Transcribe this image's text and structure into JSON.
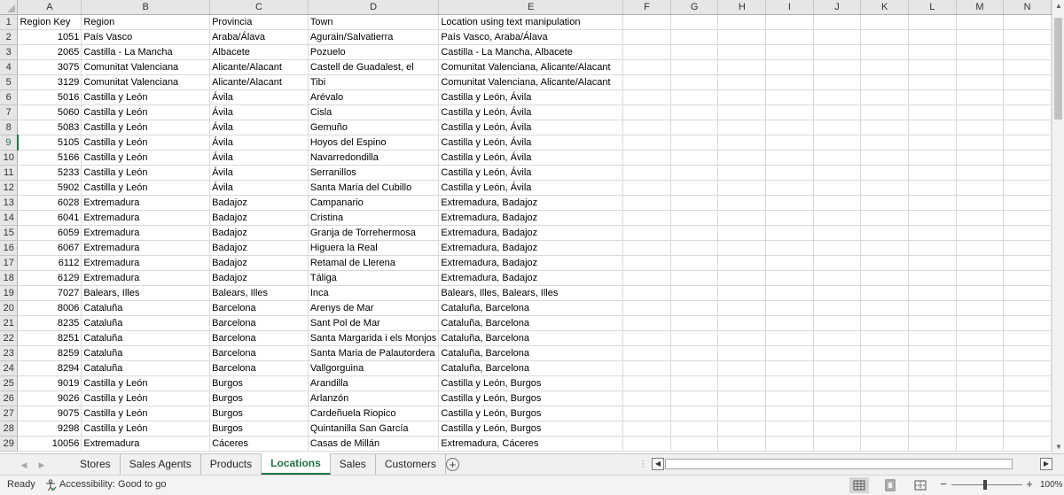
{
  "columns": [
    "A",
    "B",
    "C",
    "D",
    "E",
    "F",
    "G",
    "H",
    "I",
    "J",
    "K",
    "L",
    "M",
    "N"
  ],
  "rows": [
    [
      "Region Key",
      "Region",
      "Provincia",
      "Town",
      "Location using text manipulation"
    ],
    [
      "1051",
      "País Vasco",
      "Araba/Álava",
      "Agurain/Salvatierra",
      "País Vasco, Araba/Álava"
    ],
    [
      "2065",
      "Castilla - La Mancha",
      "Albacete",
      "Pozuelo",
      "Castilla - La Mancha, Albacete"
    ],
    [
      "3075",
      "Comunitat Valenciana",
      "Alicante/Alacant",
      "Castell de Guadalest, el",
      "Comunitat Valenciana, Alicante/Alacant"
    ],
    [
      "3129",
      "Comunitat Valenciana",
      "Alicante/Alacant",
      "Tibi",
      "Comunitat Valenciana, Alicante/Alacant"
    ],
    [
      "5016",
      "Castilla y León",
      "Ávila",
      "Arévalo",
      "Castilla y León, Ávila"
    ],
    [
      "5060",
      "Castilla y León",
      "Ávila",
      "Cisla",
      "Castilla y León, Ávila"
    ],
    [
      "5083",
      "Castilla y León",
      "Ávila",
      "Gemuño",
      "Castilla y León, Ávila"
    ],
    [
      "5105",
      "Castilla y León",
      "Ávila",
      "Hoyos del Espino",
      "Castilla y León, Ávila"
    ],
    [
      "5166",
      "Castilla y León",
      "Ávila",
      "Navarredondilla",
      "Castilla y León, Ávila"
    ],
    [
      "5233",
      "Castilla y León",
      "Ávila",
      "Serranillos",
      "Castilla y León, Ávila"
    ],
    [
      "5902",
      "Castilla y León",
      "Ávila",
      "Santa María del Cubillo",
      "Castilla y León, Ávila"
    ],
    [
      "6028",
      "Extremadura",
      "Badajoz",
      "Campanario",
      "Extremadura, Badajoz"
    ],
    [
      "6041",
      "Extremadura",
      "Badajoz",
      "Cristina",
      "Extremadura, Badajoz"
    ],
    [
      "6059",
      "Extremadura",
      "Badajoz",
      "Granja de Torrehermosa",
      "Extremadura, Badajoz"
    ],
    [
      "6067",
      "Extremadura",
      "Badajoz",
      "Higuera la Real",
      "Extremadura, Badajoz"
    ],
    [
      "6112",
      "Extremadura",
      "Badajoz",
      "Retamal de Llerena",
      "Extremadura, Badajoz"
    ],
    [
      "6129",
      "Extremadura",
      "Badajoz",
      "Táliga",
      "Extremadura, Badajoz"
    ],
    [
      "7027",
      "Balears, Illes",
      "Balears, Illes",
      "Inca",
      "Balears, Illes, Balears, Illes"
    ],
    [
      "8006",
      "Cataluña",
      "Barcelona",
      "Arenys de Mar",
      "Cataluña, Barcelona"
    ],
    [
      "8235",
      "Cataluña",
      "Barcelona",
      "Sant Pol de Mar",
      "Cataluña, Barcelona"
    ],
    [
      "8251",
      "Cataluña",
      "Barcelona",
      "Santa Margarida i els Monjos",
      "Cataluña, Barcelona"
    ],
    [
      "8259",
      "Cataluña",
      "Barcelona",
      "Santa Maria de Palautordera",
      "Cataluña, Barcelona"
    ],
    [
      "8294",
      "Cataluña",
      "Barcelona",
      "Vallgorguina",
      "Cataluña, Barcelona"
    ],
    [
      "9019",
      "Castilla y León",
      "Burgos",
      "Arandilla",
      "Castilla y León, Burgos"
    ],
    [
      "9026",
      "Castilla y León",
      "Burgos",
      "Arlanzón",
      "Castilla y León, Burgos"
    ],
    [
      "9075",
      "Castilla y León",
      "Burgos",
      "Cardeñuela Riopico",
      "Castilla y León, Burgos"
    ],
    [
      "9298",
      "Castilla y León",
      "Burgos",
      "Quintanilla San García",
      "Castilla y León, Burgos"
    ],
    [
      "10056",
      "Extremadura",
      "Cáceres",
      "Casas de Millán",
      "Extremadura, Cáceres"
    ]
  ],
  "active_row": 9,
  "sheet_tabs": [
    "Stores",
    "Sales Agents",
    "Products",
    "Locations",
    "Sales",
    "Customers"
  ],
  "active_tab": "Locations",
  "status": {
    "ready": "Ready",
    "accessibility": "Accessibility: Good to go",
    "zoom": "100%"
  },
  "accent_color": "#217346"
}
